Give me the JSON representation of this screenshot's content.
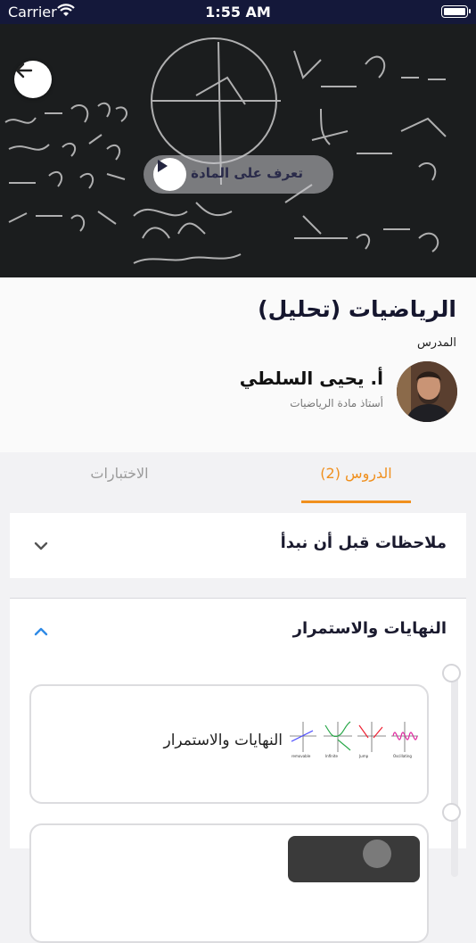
{
  "status_bar": {
    "carrier": "Carrier",
    "time": "1:55 AM"
  },
  "hero": {
    "intro_label": "تعرف على المادة"
  },
  "course": {
    "title": "الرياضيات (تحليل)",
    "teacher_label": "المدرس",
    "teacher_name": "أ. يحيى السلطي",
    "teacher_subtitle": "أستاذ مادة الرياضيات"
  },
  "tabs": [
    {
      "label": "الدروس (2)",
      "active": true
    },
    {
      "label": "الاختبارات",
      "active": false
    }
  ],
  "sections": [
    {
      "title": "ملاحظات قبل أن نبدأ",
      "expanded": false,
      "chevron": "chevron-down-icon"
    },
    {
      "title": "النهايات والاستمرار",
      "expanded": true,
      "chevron": "chevron-up-icon"
    }
  ],
  "lessons": [
    {
      "title": "النهايات والاستمرار"
    },
    {
      "title": ""
    }
  ],
  "colors": {
    "accent": "#f0901e",
    "status_bar": "#14183a",
    "chevron_active": "#2e8ae6"
  }
}
